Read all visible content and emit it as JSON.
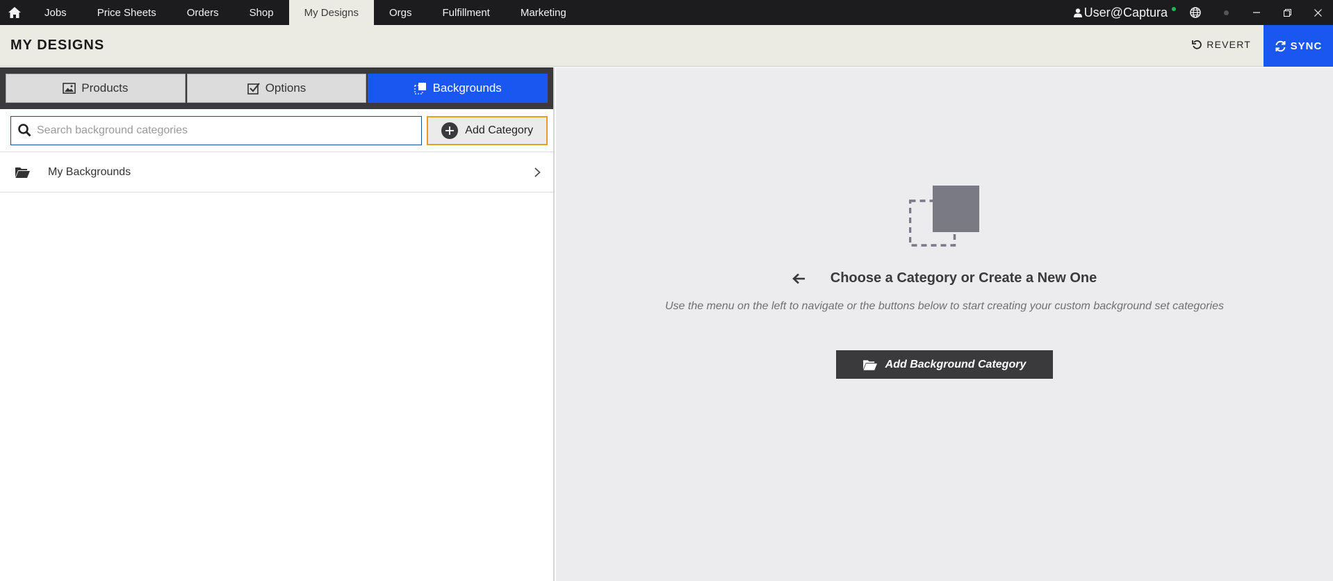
{
  "topnav": {
    "items": [
      {
        "label": "Jobs",
        "active": false
      },
      {
        "label": "Price Sheets",
        "active": false
      },
      {
        "label": "Orders",
        "active": false
      },
      {
        "label": "Shop",
        "active": false
      },
      {
        "label": "My Designs",
        "active": true
      },
      {
        "label": "Orgs",
        "active": false
      },
      {
        "label": "Fulfillment",
        "active": false
      },
      {
        "label": "Marketing",
        "active": false
      }
    ],
    "user": "User@Captura",
    "status_color": "#1db954"
  },
  "header": {
    "title": "MY DESIGNS",
    "revert_label": "REVERT",
    "sync_label": "SYNC"
  },
  "tabs": [
    {
      "label": "Products",
      "icon": "image-icon",
      "active": false
    },
    {
      "label": "Options",
      "icon": "checkbox-icon",
      "active": false
    },
    {
      "label": "Backgrounds",
      "icon": "background-icon",
      "active": true
    }
  ],
  "search": {
    "placeholder": "Search background categories",
    "value": ""
  },
  "add_category_label": "Add Category",
  "categories": [
    {
      "label": "My Backgrounds",
      "icon": "folder-open-icon"
    }
  ],
  "empty_state": {
    "heading": "Choose a Category or Create a New One",
    "subtext": "Use the menu on the left to navigate or the buttons below to start creating your custom background set categories",
    "button_label": "Add Background Category"
  },
  "colors": {
    "accent": "#1a56f0",
    "dark": "#1c1c1e",
    "header_bg": "#ecebe3",
    "highlight_border": "#e0a020"
  }
}
